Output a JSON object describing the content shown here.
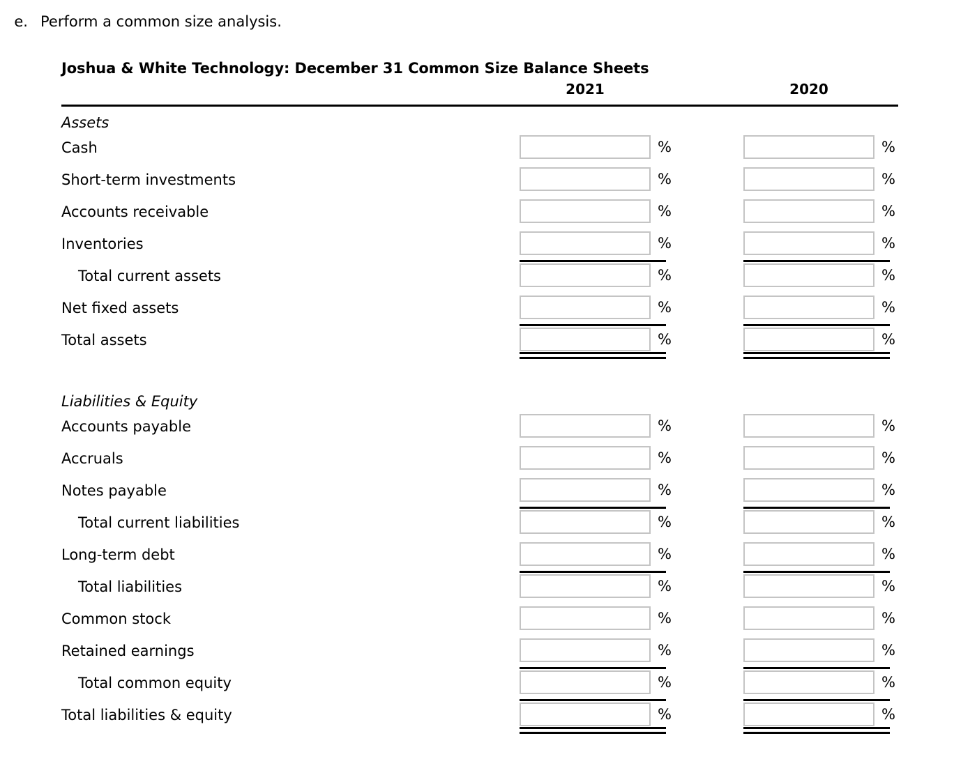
{
  "question": {
    "marker": "e.",
    "text": "Perform a common size analysis."
  },
  "sheet": {
    "title": "Joshua & White Technology: December 31 Common Size Balance Sheets",
    "columns": [
      {
        "year": "2021"
      },
      {
        "year": "2020"
      }
    ],
    "unit_symbol": "%",
    "sections": [
      {
        "heading": "Assets",
        "rows": [
          {
            "label": "Cash",
            "indent": false,
            "rule_above": false,
            "double_rule_below": false,
            "values": [
              "",
              ""
            ]
          },
          {
            "label": "Short-term investments",
            "indent": false,
            "rule_above": false,
            "double_rule_below": false,
            "values": [
              "",
              ""
            ]
          },
          {
            "label": "Accounts receivable",
            "indent": false,
            "rule_above": false,
            "double_rule_below": false,
            "values": [
              "",
              ""
            ]
          },
          {
            "label": "Inventories",
            "indent": false,
            "rule_above": false,
            "double_rule_below": false,
            "values": [
              "",
              ""
            ]
          },
          {
            "label": "Total current assets",
            "indent": true,
            "rule_above": true,
            "double_rule_below": false,
            "values": [
              "",
              ""
            ]
          },
          {
            "label": "Net fixed assets",
            "indent": false,
            "rule_above": false,
            "double_rule_below": false,
            "values": [
              "",
              ""
            ]
          },
          {
            "label": "Total assets",
            "indent": false,
            "rule_above": true,
            "double_rule_below": true,
            "values": [
              "",
              ""
            ]
          }
        ]
      },
      {
        "heading": "Liabilities & Equity",
        "rows": [
          {
            "label": "Accounts payable",
            "indent": false,
            "rule_above": false,
            "double_rule_below": false,
            "values": [
              "",
              ""
            ]
          },
          {
            "label": "Accruals",
            "indent": false,
            "rule_above": false,
            "double_rule_below": false,
            "values": [
              "",
              ""
            ]
          },
          {
            "label": "Notes payable",
            "indent": false,
            "rule_above": false,
            "double_rule_below": false,
            "values": [
              "",
              ""
            ]
          },
          {
            "label": "Total current liabilities",
            "indent": true,
            "rule_above": true,
            "double_rule_below": false,
            "values": [
              "",
              ""
            ]
          },
          {
            "label": "Long-term debt",
            "indent": false,
            "rule_above": false,
            "double_rule_below": false,
            "values": [
              "",
              ""
            ]
          },
          {
            "label": "Total liabilities",
            "indent": true,
            "rule_above": true,
            "double_rule_below": false,
            "values": [
              "",
              ""
            ]
          },
          {
            "label": "Common stock",
            "indent": false,
            "rule_above": false,
            "double_rule_below": false,
            "values": [
              "",
              ""
            ]
          },
          {
            "label": "Retained earnings",
            "indent": false,
            "rule_above": false,
            "double_rule_below": false,
            "values": [
              "",
              ""
            ]
          },
          {
            "label": "Total common equity",
            "indent": true,
            "rule_above": true,
            "double_rule_below": false,
            "values": [
              "",
              ""
            ]
          },
          {
            "label": "Total liabilities & equity",
            "indent": false,
            "rule_above": true,
            "double_rule_below": true,
            "values": [
              "",
              ""
            ]
          }
        ]
      }
    ]
  },
  "colors": {
    "text": "#000000",
    "page_background": "#ffffff",
    "input_border": "#c4c4c4",
    "rule": "#000000"
  }
}
